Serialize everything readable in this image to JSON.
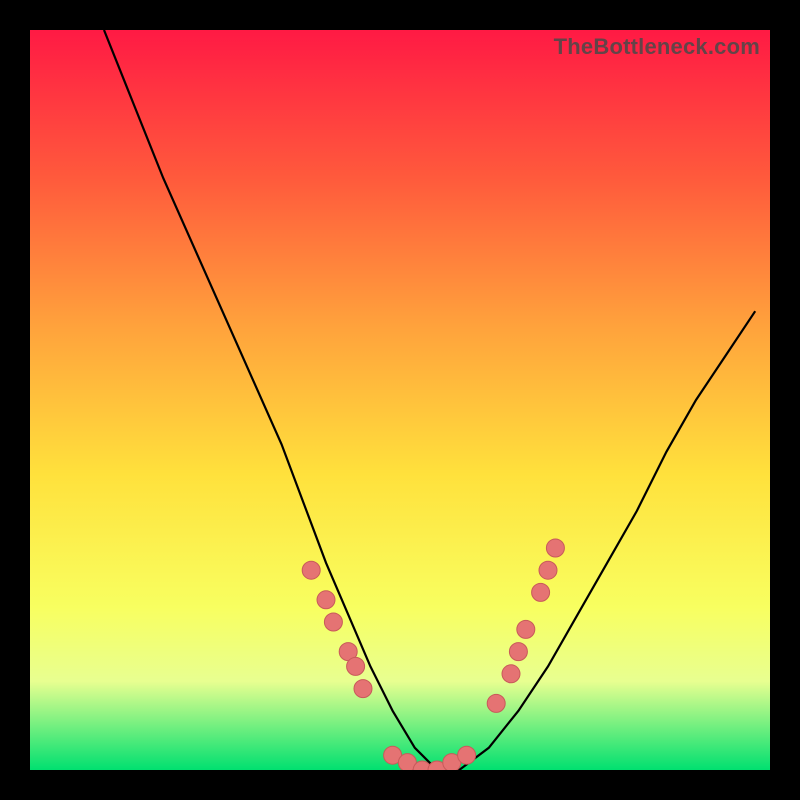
{
  "watermark": "TheBottleneck.com",
  "colors": {
    "gradient_top": "#ff1a44",
    "gradient_bottom": "#00e070",
    "curve": "#000000",
    "marker_fill": "#e57373",
    "marker_stroke": "#c85a5a"
  },
  "chart_data": {
    "type": "line",
    "title": "",
    "xlabel": "",
    "ylabel": "",
    "xlim": [
      0,
      100
    ],
    "ylim": [
      0,
      100
    ],
    "grid": false,
    "series": [
      {
        "name": "bottleneck-curve",
        "x": [
          10,
          14,
          18,
          22,
          26,
          30,
          34,
          37,
          40,
          43,
          46,
          49,
          52,
          55,
          58,
          62,
          66,
          70,
          74,
          78,
          82,
          86,
          90,
          94,
          98
        ],
        "y": [
          100,
          90,
          80,
          71,
          62,
          53,
          44,
          36,
          28,
          21,
          14,
          8,
          3,
          0,
          0,
          3,
          8,
          14,
          21,
          28,
          35,
          43,
          50,
          56,
          62
        ]
      }
    ],
    "markers": [
      {
        "name": "left-dot-1",
        "x": 38,
        "y": 27
      },
      {
        "name": "left-dot-2",
        "x": 40,
        "y": 23
      },
      {
        "name": "left-dot-3",
        "x": 41,
        "y": 20
      },
      {
        "name": "left-dot-4",
        "x": 43,
        "y": 16
      },
      {
        "name": "left-dot-5",
        "x": 44,
        "y": 14
      },
      {
        "name": "left-dot-6",
        "x": 45,
        "y": 11
      },
      {
        "name": "bottom-1",
        "x": 49,
        "y": 2
      },
      {
        "name": "bottom-2",
        "x": 51,
        "y": 1
      },
      {
        "name": "bottom-3",
        "x": 53,
        "y": 0
      },
      {
        "name": "bottom-4",
        "x": 55,
        "y": 0
      },
      {
        "name": "bottom-5",
        "x": 57,
        "y": 1
      },
      {
        "name": "bottom-6",
        "x": 59,
        "y": 2
      },
      {
        "name": "right-dot-1",
        "x": 63,
        "y": 9
      },
      {
        "name": "right-dot-2",
        "x": 65,
        "y": 13
      },
      {
        "name": "right-dot-3",
        "x": 66,
        "y": 16
      },
      {
        "name": "right-dot-4",
        "x": 67,
        "y": 19
      },
      {
        "name": "right-dot-5",
        "x": 69,
        "y": 24
      },
      {
        "name": "right-dot-6",
        "x": 70,
        "y": 27
      },
      {
        "name": "right-dot-7",
        "x": 71,
        "y": 30
      }
    ]
  }
}
